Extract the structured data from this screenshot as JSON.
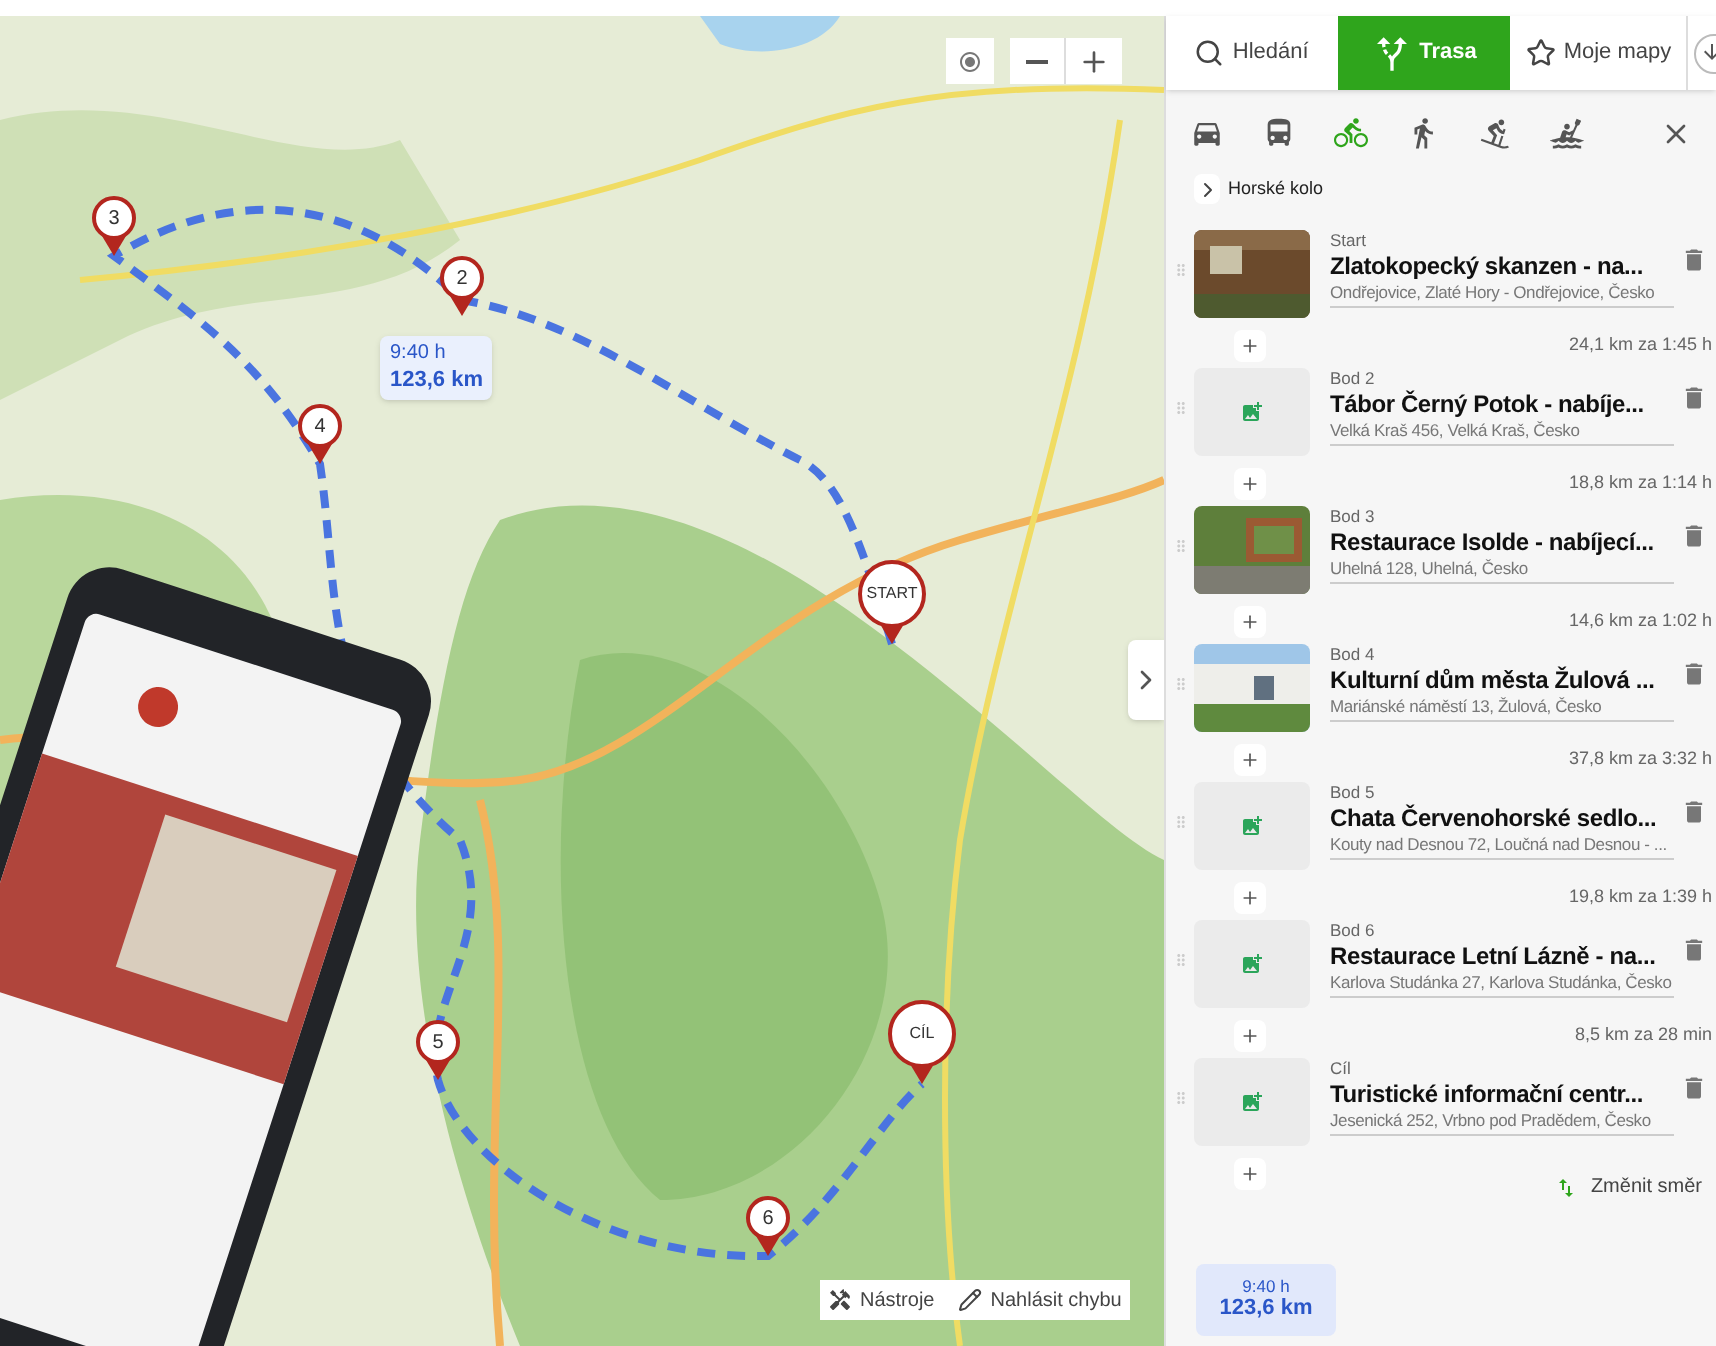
{
  "map": {
    "markers": [
      {
        "label": "3"
      },
      {
        "label": "2"
      },
      {
        "label": "4"
      },
      {
        "label": "START"
      },
      {
        "label": "5"
      },
      {
        "label": "CÍL"
      },
      {
        "label": "6"
      }
    ],
    "route_bubble": {
      "time": "9:40 h",
      "distance": "123,6 km"
    },
    "tools": [
      {
        "kind": "tools",
        "label": "Nástroje"
      },
      {
        "kind": "report",
        "label": "Nahlásit chybu"
      }
    ]
  },
  "sidebar": {
    "tabs": [
      {
        "kind": "search",
        "label": "Hledání",
        "selected": false
      },
      {
        "kind": "route",
        "label": "Trasa",
        "selected": true
      },
      {
        "kind": "star",
        "label": "Moje mapy",
        "selected": false
      }
    ],
    "transport_modes": [
      {
        "kind": "car",
        "selected": false
      },
      {
        "kind": "bus",
        "selected": false
      },
      {
        "kind": "bike",
        "selected": true
      },
      {
        "kind": "walk",
        "selected": false
      },
      {
        "kind": "ski",
        "selected": false
      },
      {
        "kind": "boat",
        "selected": false
      }
    ],
    "profile": "Horské kolo",
    "waypoints": [
      {
        "label": "Start",
        "name": "Zlatokopecký skanzen - na...",
        "address": "Ondřejovice, Zlaté Hory - Ondřejovice, Česko",
        "photo": true,
        "leg": "24,1 km za 1:45 h"
      },
      {
        "label": "Bod 2",
        "name": "Tábor Černý Potok - nabíje...",
        "address": "Velká Kraš 456, Velká Kraš, Česko",
        "photo": false,
        "leg": "18,8 km za 1:14 h"
      },
      {
        "label": "Bod 3",
        "name": "Restaurace Isolde - nabíjecí...",
        "address": "Uhelná 128, Uhelná, Česko",
        "photo": true,
        "leg": "14,6 km za 1:02 h"
      },
      {
        "label": "Bod 4",
        "name": "Kulturní dům města Žulová ...",
        "address": "Mariánské náměstí 13, Žulová, Česko",
        "photo": true,
        "leg": "37,8 km za 3:32 h"
      },
      {
        "label": "Bod 5",
        "name": "Chata Červenohorské sedlo...",
        "address": "Kouty nad Desnou 72, Loučná nad Desnou - ...",
        "photo": false,
        "leg": "19,8 km za 1:39 h"
      },
      {
        "label": "Bod 6",
        "name": "Restaurace Letní Lázně - na...",
        "address": "Karlova Studánka 27, Karlova Studánka, Česko",
        "photo": false,
        "leg": "8,5 km za 28 min"
      },
      {
        "label": "Cíl",
        "name": "Turistické informační centr...",
        "address": "Jesenická 252, Vrbno pod Pradědem, Česko",
        "photo": false
      }
    ],
    "reverse_button": "Změnit směr",
    "summary": {
      "time": "9:40 h",
      "distance": "123,6 km"
    }
  }
}
